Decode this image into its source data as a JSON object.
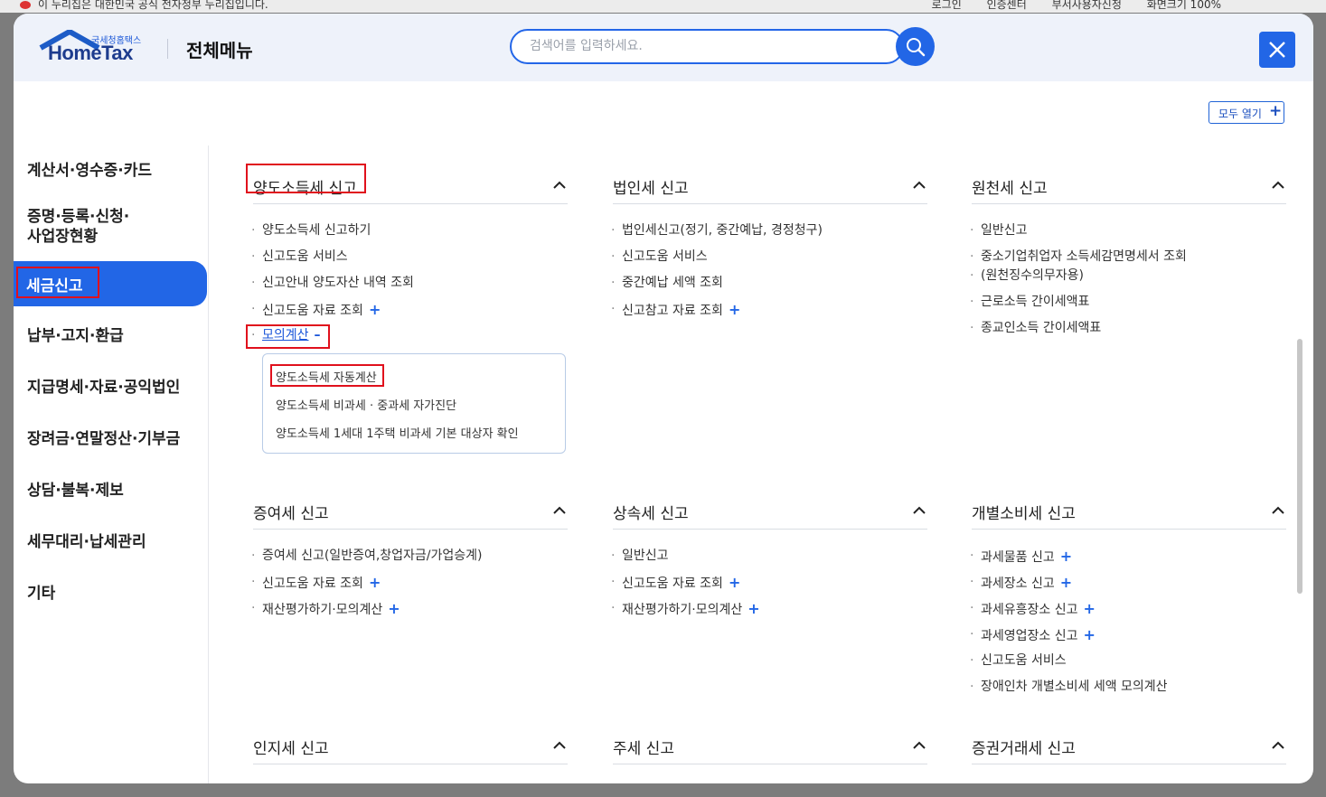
{
  "browser_bar": {
    "notice": "이 누리집은 대한민국 공식 전자정부 누리집입니다.",
    "links": [
      "로그인",
      "인증센터",
      "부서사용자신청",
      "화면크기 100%"
    ]
  },
  "header": {
    "logo_sub": "국세청홈택스",
    "logo_main": "HomeTax",
    "title": "전체메뉴",
    "search_placeholder": "검색어를 입력하세요."
  },
  "open_all": {
    "label": "모두 열기",
    "icon": "+"
  },
  "sidebar": {
    "items": [
      "계산서·영수증·카드",
      "증명·등록·신청·",
      "사업장현황",
      "세금신고",
      "납부·고지·환급",
      "지급명세·자료·공익법인",
      "장려금·연말정산·기부금",
      "상담·불복·제보",
      "세무대리·납세관리",
      "기타"
    ],
    "active": "세금신고"
  },
  "sections": {
    "s1": {
      "title": "양도소득세 신고",
      "items": [
        "양도소득세 신고하기",
        "신고도움 서비스",
        "신고안내 양도자산 내역 조회",
        "신고도움 자료 조회",
        "모의계산"
      ],
      "submenu": [
        "양도소득세 자동계산",
        "양도소득세 비과세 · 중과세 자가진단",
        "양도소득세 1세대 1주택 비과세 기본 대상자 확인"
      ]
    },
    "s2": {
      "title": "법인세 신고",
      "items": [
        "법인세신고(정기, 중간예납, 경정청구)",
        "신고도움 서비스",
        "중간예납 세액 조회",
        "신고참고 자료 조회"
      ]
    },
    "s3": {
      "title": "원천세 신고",
      "items": [
        "일반신고",
        "중소기업취업자 소득세감면명세서 조회",
        "(원천징수의무자용)",
        "근로소득 간이세액표",
        "종교인소득 간이세액표"
      ]
    },
    "s4": {
      "title": "증여세 신고",
      "items": [
        "증여세 신고(일반증여,창업자금/가업승계)",
        "신고도움 자료 조회",
        "재산평가하기·모의계산"
      ]
    },
    "s5": {
      "title": "상속세 신고",
      "items": [
        "일반신고",
        "신고도움 자료 조회",
        "재산평가하기·모의계산"
      ]
    },
    "s6": {
      "title": "개별소비세 신고",
      "items": [
        "과세물품 신고",
        "과세장소 신고",
        "과세유흥장소 신고",
        "과세영업장소 신고",
        "신고도움 서비스",
        "장애인차 개별소비세 세액 모의계산"
      ]
    },
    "s7": {
      "title": "인지세 신고"
    },
    "s8": {
      "title": "주세 신고"
    },
    "s9": {
      "title": "증권거래세 신고"
    }
  },
  "colors": {
    "accent": "#2266e6",
    "highlight_box": "#e0101c",
    "header_bg": "#eef2fa"
  }
}
